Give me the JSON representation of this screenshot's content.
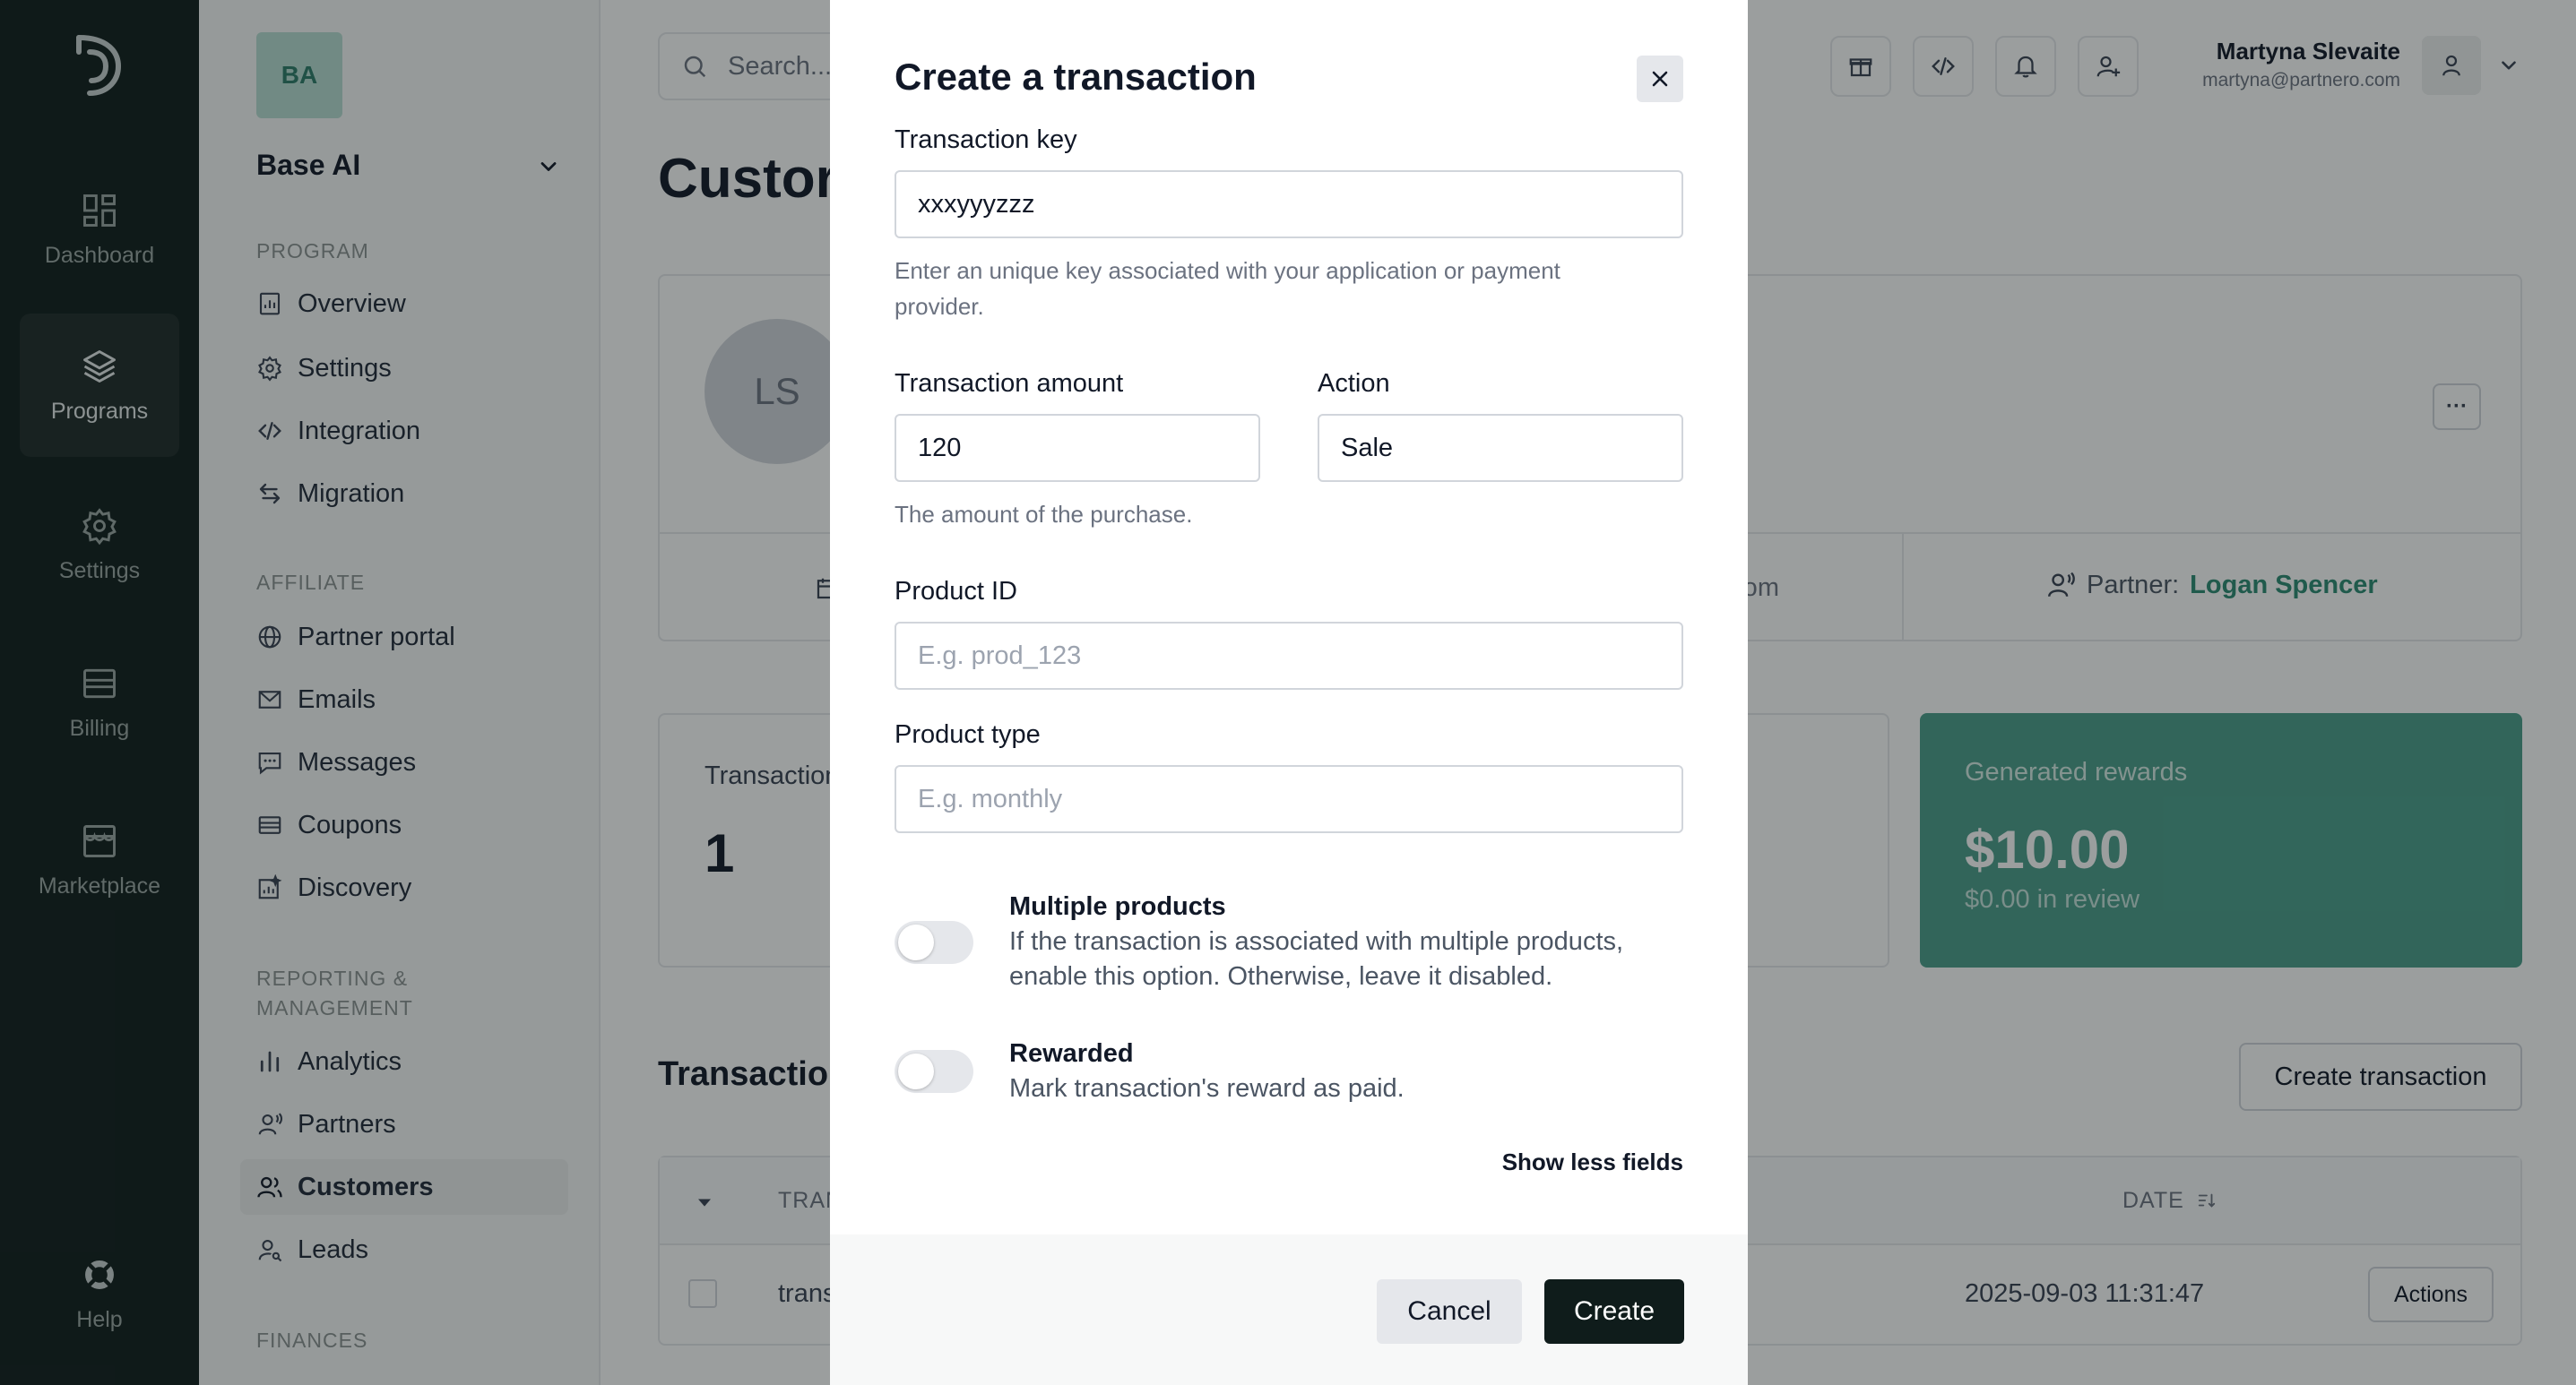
{
  "rail": {
    "items": [
      {
        "label": "Dashboard",
        "icon": "dashboard-icon"
      },
      {
        "label": "Programs",
        "icon": "layers-icon",
        "active": true
      },
      {
        "label": "Settings",
        "icon": "gear-icon"
      },
      {
        "label": "Billing",
        "icon": "billing-icon"
      },
      {
        "label": "Marketplace",
        "icon": "store-icon"
      }
    ],
    "help_label": "Help"
  },
  "sidebar": {
    "org_initials": "BA",
    "org_name": "Base AI",
    "sections": {
      "program": "PROGRAM",
      "affiliate": "AFFILIATE",
      "reporting_line1": "REPORTING &",
      "reporting_line2": "MANAGEMENT",
      "finances": "FINANCES"
    },
    "program_items": [
      "Overview",
      "Settings",
      "Integration",
      "Migration"
    ],
    "affiliate_items": [
      "Partner portal",
      "Emails",
      "Messages",
      "Coupons",
      "Discovery"
    ],
    "reporting_items": [
      "Analytics",
      "Partners",
      "Customers",
      "Leads"
    ],
    "active_item": "Customers"
  },
  "header": {
    "search_placeholder": "Search...",
    "user_name": "Martyna Slevaite",
    "user_email": "martyna@partnero.com"
  },
  "main": {
    "page_title_fragment": "Custor",
    "profile_initials": "LS",
    "more_label": "···",
    "email_fragment": "e.com",
    "partner_label": "Partner:",
    "partner_name": "Logan Spencer",
    "stat_label_fragment": "Transaction",
    "stat_value": "1",
    "rewards_label": "Generated rewards",
    "rewards_value": "$10.00",
    "rewards_sub": "$0.00 in review",
    "transactions_title_fragment": "Transaction",
    "create_transaction_label": "Create transaction",
    "table": {
      "col_tx_fragment": "TRAN",
      "col_date": "DATE",
      "row_tx_fragment": "trans",
      "row_date": "2025-09-03 11:31:47",
      "row_actions": "Actions"
    }
  },
  "modal": {
    "title": "Create a transaction",
    "transaction_key": {
      "label": "Transaction key",
      "value": "xxxyyyzzz",
      "help_line1": "Enter an unique key associated with your application or payment",
      "help_line2": "provider."
    },
    "transaction_amount": {
      "label": "Transaction amount",
      "value": "120",
      "help": "The amount of the purchase."
    },
    "action": {
      "label": "Action",
      "value": "Sale"
    },
    "product_id": {
      "label": "Product ID",
      "placeholder": "E.g. prod_123"
    },
    "product_type": {
      "label": "Product type",
      "placeholder": "E.g. monthly"
    },
    "multiple_products": {
      "title": "Multiple products",
      "desc_line1": "If the transaction is associated with multiple products,",
      "desc_line2": "enable this option. Otherwise, leave it disabled.",
      "enabled": false
    },
    "rewarded": {
      "title": "Rewarded",
      "desc": "Mark transaction's reward as paid.",
      "enabled": false
    },
    "show_less_label": "Show less fields",
    "cancel_label": "Cancel",
    "create_label": "Create"
  },
  "colors": {
    "rail_bg": "#0f1c1b",
    "accent": "#4a9e8b",
    "link": "#2b8a72"
  }
}
